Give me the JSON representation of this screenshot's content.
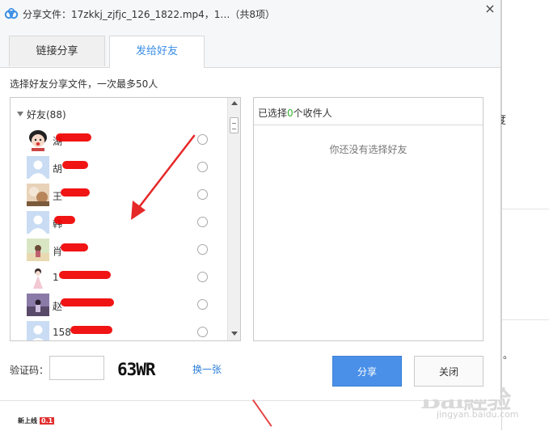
{
  "dialog": {
    "title": "分享文件：17zkkj_zjfjc_126_1822.mp4，1…（共8项）",
    "close_icon": "×"
  },
  "tabs": [
    {
      "label": "链接分享",
      "active": false
    },
    {
      "label": "发给好友",
      "active": true
    }
  ],
  "instruction": "选择好友分享文件，一次最多50人",
  "friend_group": {
    "label": "好友(88)"
  },
  "friends": [
    {
      "name": "湖",
      "avatar": "emoji-face"
    },
    {
      "name": "胡",
      "avatar": "default-person"
    },
    {
      "name": "王",
      "avatar": "photo-flowers"
    },
    {
      "name": "韩",
      "avatar": "default-person"
    },
    {
      "name": "肖",
      "avatar": "photo-beach"
    },
    {
      "name": "1",
      "avatar": "illustrated-girl"
    },
    {
      "name": "赵",
      "avatar": "photo-road"
    },
    {
      "name": "158",
      "avatar": "default-person"
    }
  ],
  "selected_panel": {
    "prefix": "已选择",
    "count": "0",
    "suffix": "个收件人",
    "empty_text": "你还没有选择好友"
  },
  "captcha": {
    "label": "验证码：",
    "value": "",
    "image_text": "63WR",
    "refresh_label": "换一张"
  },
  "buttons": {
    "share": "分享",
    "close": "关闭"
  },
  "background": {
    "right_char": "度",
    "dot": "。",
    "watermark": "Bai經验",
    "watermark_sub": "jingyan.baidu.com",
    "bottom_logo": "新上线",
    "bottom_logo_tag": "0.1"
  },
  "colors": {
    "accent_blue": "#4a90e8",
    "link_blue": "#2d7ed8",
    "selected_count_green": "#2fb32f",
    "redaction_red": "#f00000"
  }
}
